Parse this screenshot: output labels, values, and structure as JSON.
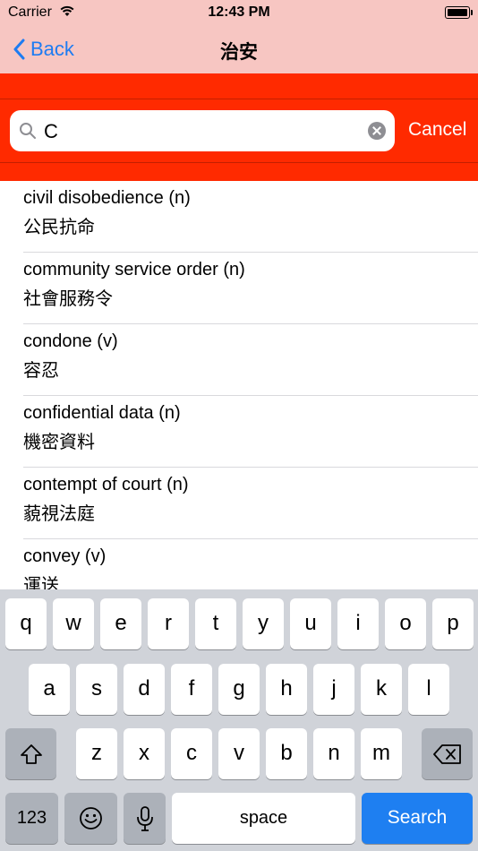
{
  "status": {
    "carrier": "Carrier",
    "time": "12:43 PM"
  },
  "nav": {
    "back_label": "Back",
    "title": "治安"
  },
  "search": {
    "value": "C",
    "cancel_label": "Cancel"
  },
  "results": [
    {
      "en": "civil disobedience (n)",
      "zh": "公民抗命"
    },
    {
      "en": "community service order (n)",
      "zh": "社會服務令"
    },
    {
      "en": "condone (v)",
      "zh": "容忍"
    },
    {
      "en": "confidential data (n)",
      "zh": "機密資料"
    },
    {
      "en": "contempt of court (n)",
      "zh": "藐視法庭"
    },
    {
      "en": "convey (v)",
      "zh": "運送"
    }
  ],
  "keyboard": {
    "row1": [
      "q",
      "w",
      "e",
      "r",
      "t",
      "y",
      "u",
      "i",
      "o",
      "p"
    ],
    "row2": [
      "a",
      "s",
      "d",
      "f",
      "g",
      "h",
      "j",
      "k",
      "l"
    ],
    "row3": [
      "z",
      "x",
      "c",
      "v",
      "b",
      "n",
      "m"
    ],
    "numbers_label": "123",
    "space_label": "space",
    "search_label": "Search"
  },
  "colors": {
    "nav_bg": "#f7c6c2",
    "search_band": "#ff2a00",
    "accent": "#1e7cf2"
  }
}
